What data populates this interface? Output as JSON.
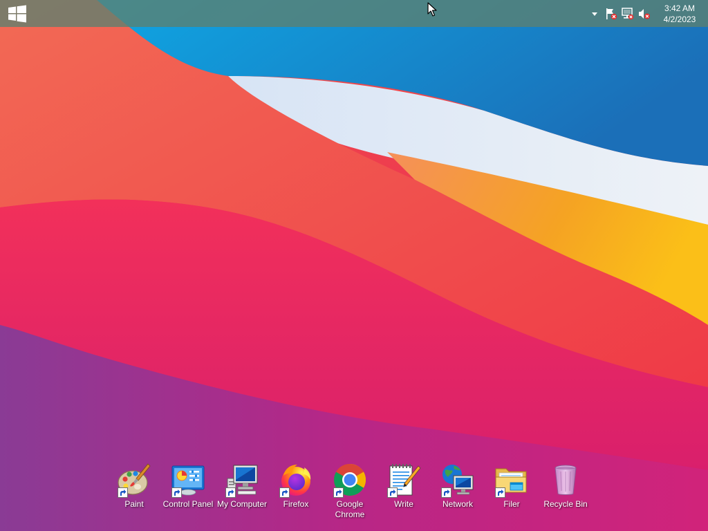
{
  "taskbar": {
    "clock": {
      "time": "3:42 AM",
      "date": "4/2/2023"
    },
    "tray_icons": [
      "tray-overflow-icon",
      "action-center-flag-icon",
      "network-disconnected-icon",
      "volume-muted-icon"
    ]
  },
  "desktop_icons": [
    {
      "label": "Paint",
      "icon": "paint-icon"
    },
    {
      "label": "Control Panel",
      "icon": "control-panel-icon"
    },
    {
      "label": "My Computer",
      "icon": "my-computer-icon"
    },
    {
      "label": "Firefox",
      "icon": "firefox-icon"
    },
    {
      "label": "Google\nChrome",
      "icon": "chrome-icon"
    },
    {
      "label": "Write",
      "icon": "write-icon"
    },
    {
      "label": "Network",
      "icon": "network-icon"
    },
    {
      "label": "Filer",
      "icon": "folder-icon"
    },
    {
      "label": "Recycle Bin",
      "icon": "recycle-bin-icon"
    }
  ],
  "colors": {
    "taskbar": "#5c8070",
    "wallpaper_red": "#f04a4a",
    "wallpaper_blue": "#1a8fd6",
    "wallpaper_orange": "#f7a21b",
    "wallpaper_magenta": "#c21e7a"
  }
}
